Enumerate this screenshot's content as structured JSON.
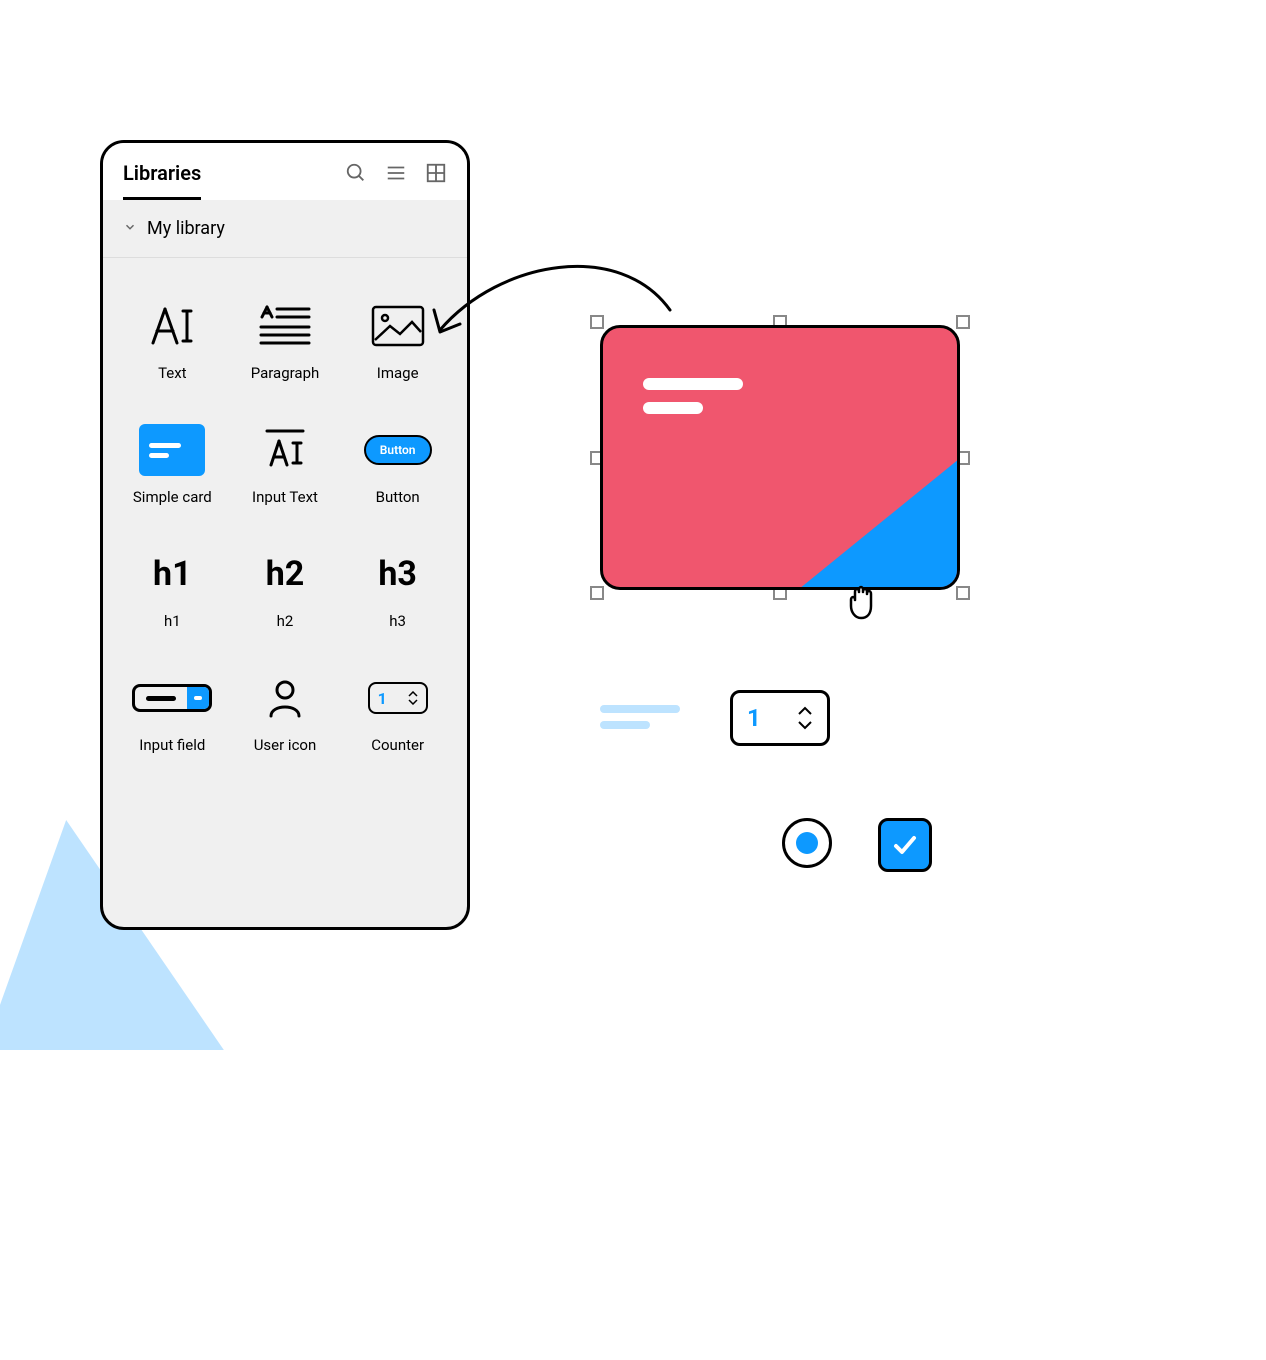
{
  "panel": {
    "tab": "Libraries",
    "section": "My library",
    "items": [
      {
        "label": "Text"
      },
      {
        "label": "Paragraph"
      },
      {
        "label": "Image"
      },
      {
        "label": "Simple card"
      },
      {
        "label": "Input Text"
      },
      {
        "label": "Button",
        "button_text": "Button"
      },
      {
        "label": "h1",
        "glyph": "h1"
      },
      {
        "label": "h2",
        "glyph": "h2"
      },
      {
        "label": "h3",
        "glyph": "h3"
      },
      {
        "label": "Input field"
      },
      {
        "label": "User icon"
      },
      {
        "label": "Counter",
        "value": "1"
      }
    ]
  },
  "canvas": {
    "counter_value": "1"
  }
}
